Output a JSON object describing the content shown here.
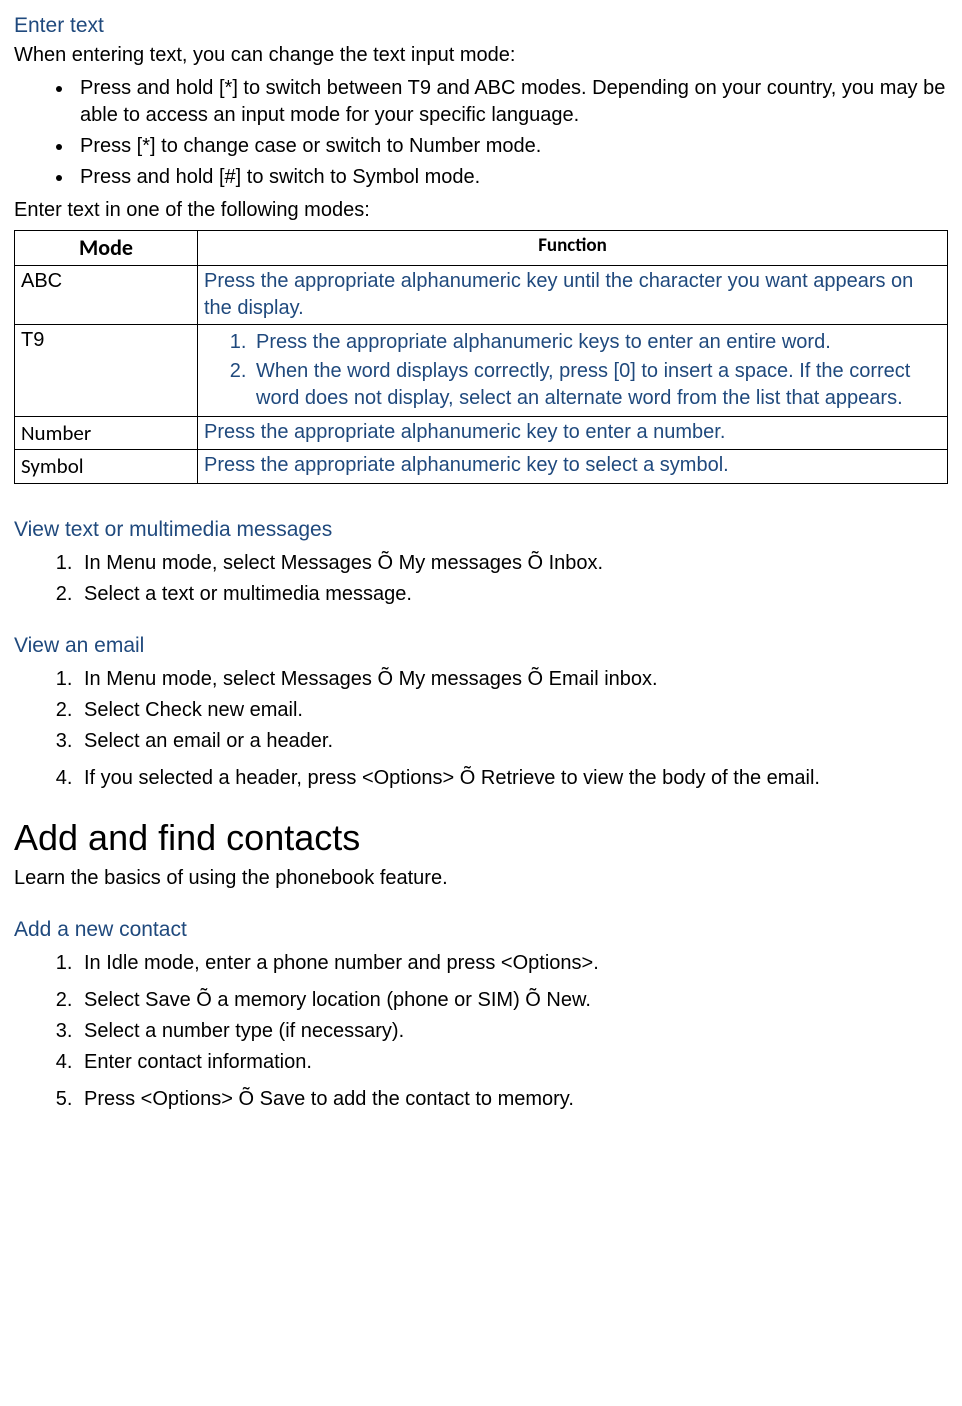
{
  "s1": {
    "title": "Enter text",
    "intro": "When entering text, you can change the text input mode:",
    "bullets": [
      "Press and hold [*] to switch between T9 and ABC modes. Depending on your country, you may be able to access an input mode for your specific language.",
      "Press [*] to change case or switch to Number mode.",
      "Press and hold [#] to switch to Symbol mode."
    ],
    "outro": "Enter text in one of the following modes:",
    "table": {
      "head_mode": "Mode",
      "head_func": "Function",
      "rows": {
        "abc": {
          "mode": "ABC",
          "func": "Press the appropriate alphanumeric key until the character you want appears on the display."
        },
        "t9": {
          "mode": "T9",
          "func1": "Press the appropriate alphanumeric keys to enter an entire word.",
          "func2": "When the word displays correctly, press [0] to insert a space. If the correct word does not display, select an alternate word from the list that appears."
        },
        "num": {
          "mode": "Number",
          "func": "Press the appropriate alphanumeric key to enter a number."
        },
        "sym": {
          "mode": "Symbol",
          "func": "Press the appropriate alphanumeric key to select a symbol."
        }
      }
    }
  },
  "s2": {
    "title": "View text or multimedia messages",
    "items": [
      "In Menu mode, select Messages Õ My messages Õ Inbox.",
      "Select a text or multimedia message."
    ]
  },
  "s3": {
    "title": "View an email",
    "items": [
      "In Menu mode, select Messages Õ My messages Õ Email inbox.",
      "Select Check new email.",
      "Select an email or a header.",
      "If you selected a header, press <Options> Õ Retrieve to view the body of the email."
    ]
  },
  "s4": {
    "title": "Add and find contacts",
    "subtitle": "Learn the basics of using the phonebook feature."
  },
  "s5": {
    "title": "Add a new contact",
    "items": [
      "In Idle mode, enter a phone number and press <Options>.",
      "Select Save Õ a memory location (phone or SIM) Õ New.",
      "Select a number type (if necessary).",
      "Enter contact information.",
      "Press <Options> Õ Save to add the contact to memory."
    ]
  }
}
